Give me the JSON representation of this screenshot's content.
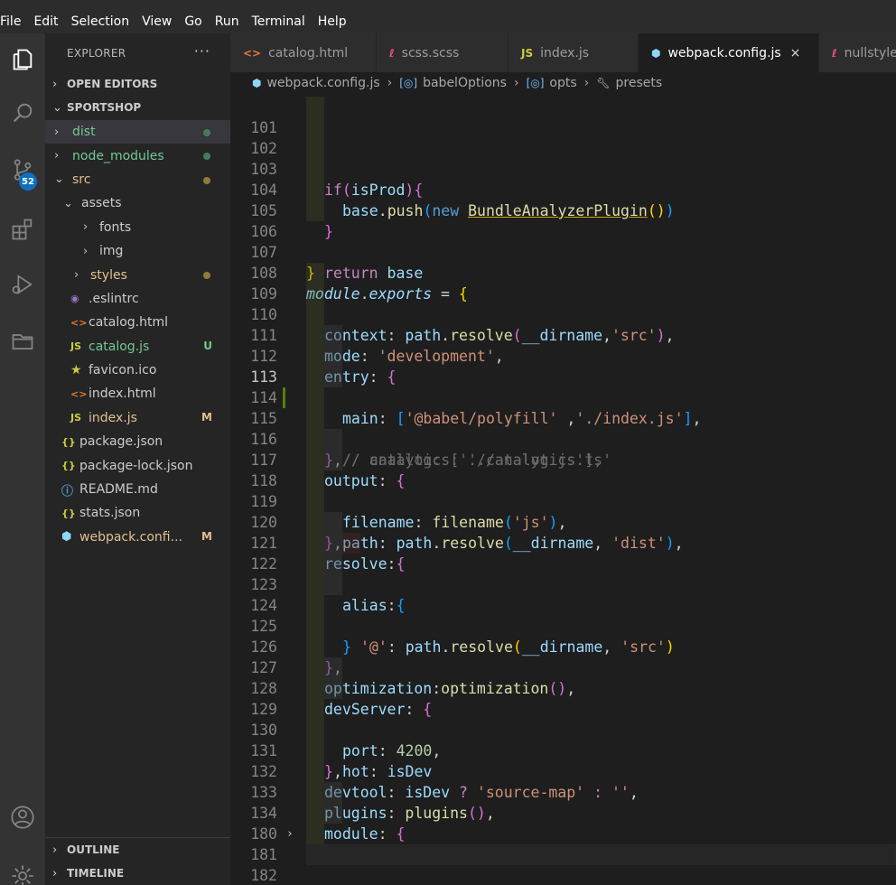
{
  "menu": {
    "items": [
      "File",
      "Edit",
      "Selection",
      "View",
      "Go",
      "Run",
      "Terminal",
      "Help"
    ]
  },
  "activity": {
    "scm_badge": "52"
  },
  "explorer": {
    "title": "EXPLORER",
    "more": "···",
    "open_editors": "OPEN EDITORS",
    "project": "SPORTSHOP",
    "items": [
      {
        "label": "dist"
      },
      {
        "label": "node_modules"
      },
      {
        "label": "src"
      },
      {
        "label": "assets"
      },
      {
        "label": "fonts"
      },
      {
        "label": "img"
      },
      {
        "label": "styles"
      },
      {
        "label": ".eslintrc"
      },
      {
        "label": "catalog.html"
      },
      {
        "label": "catalog.js",
        "status": "U"
      },
      {
        "label": "favicon.ico"
      },
      {
        "label": "index.html"
      },
      {
        "label": "index.js",
        "status": "M"
      },
      {
        "label": "package.json"
      },
      {
        "label": "package-lock.json"
      },
      {
        "label": "README.md"
      },
      {
        "label": "stats.json"
      },
      {
        "label": "webpack.confi...",
        "status": "M"
      }
    ],
    "outline": "OUTLINE",
    "timeline": "TIMELINE"
  },
  "tabs": [
    {
      "label": "catalog.html"
    },
    {
      "label": "scss.scss"
    },
    {
      "label": "index.js"
    },
    {
      "label": "webpack.config.js",
      "close": "×"
    },
    {
      "label": "nullstyle"
    }
  ],
  "breadcrumb": [
    "webpack.config.js",
    "babelOptions",
    "opts",
    "presets"
  ],
  "line_numbers": [
    "101",
    "102",
    "103",
    "104",
    "105",
    "106",
    "107",
    "108",
    "109",
    "110",
    "111",
    "112",
    "113",
    "114",
    "115",
    "116",
    "117",
    "118",
    "119",
    "120",
    "121",
    "122",
    "123",
    "124",
    "125",
    "126",
    "127",
    "128",
    "129",
    "130",
    "131",
    "132",
    "133",
    "134",
    "180",
    "181",
    "182"
  ],
  "colors": {
    "accent": "#0e70c0",
    "modified": "#e2c08d",
    "untracked": "#73c991",
    "keyword": "#c586c0",
    "string": "#ce9178"
  }
}
